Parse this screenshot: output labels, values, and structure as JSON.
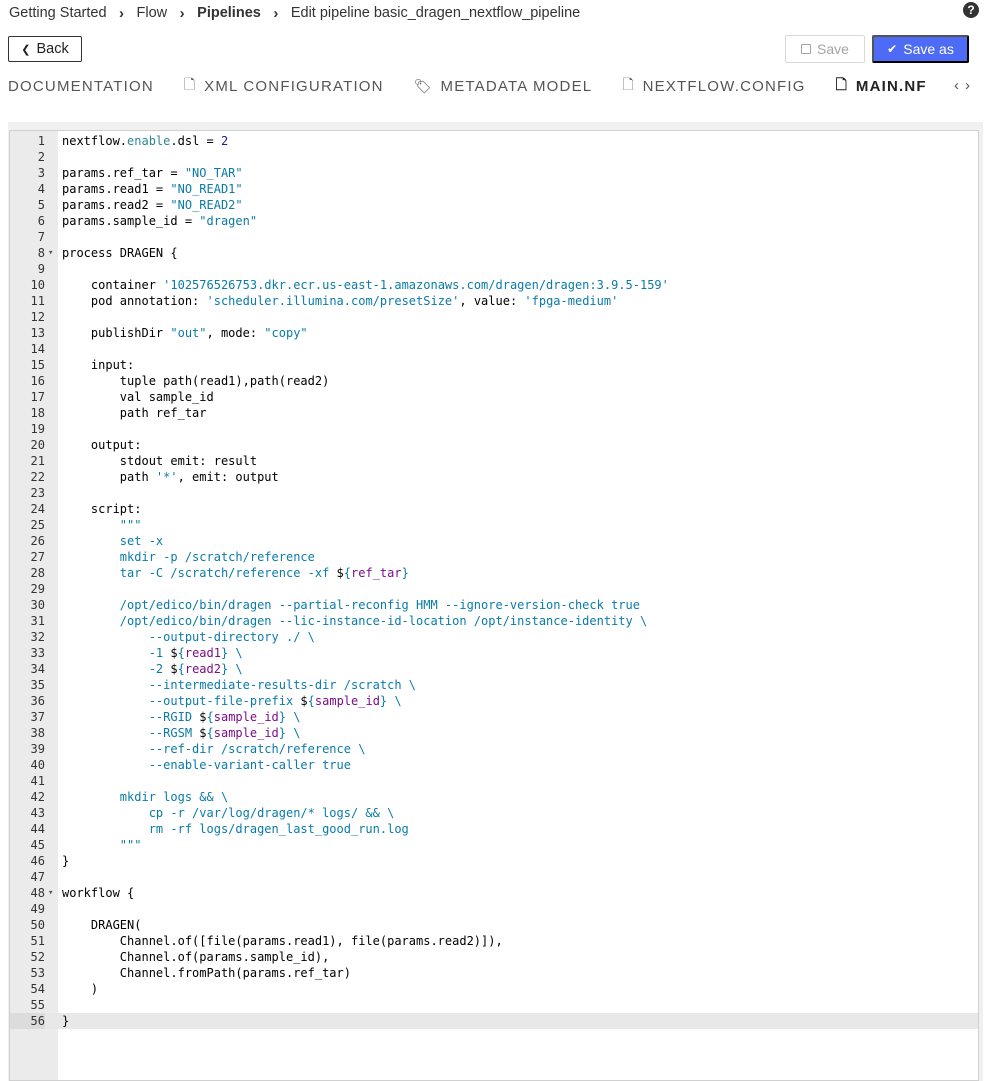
{
  "breadcrumb": {
    "items": [
      {
        "label": "Getting Started",
        "bold": false
      },
      {
        "label": "Flow",
        "bold": false
      },
      {
        "label": "Pipelines",
        "bold": true
      },
      {
        "label": "Edit pipeline basic_dragen_nextflow_pipeline",
        "bold": false
      }
    ],
    "separator": "›"
  },
  "header": {
    "help_icon": "question-circle-icon",
    "help_glyph": "?"
  },
  "toolbar": {
    "back_label": "Back",
    "back_glyph": "❮",
    "save_label": "Save",
    "save_glyph": "💾",
    "save_as_label": "Save as",
    "save_as_glyph": "✔",
    "save_as_color": "#4e6bf5"
  },
  "tabs": {
    "items": [
      {
        "label": "DOCUMENTATION",
        "icon": "",
        "active": false
      },
      {
        "label": "XML CONFIGURATION",
        "icon": "file-icon",
        "glyph": "🗋",
        "active": false
      },
      {
        "label": "METADATA MODEL",
        "icon": "tags-icon",
        "glyph": "🏷",
        "active": false
      },
      {
        "label": "NEXTFLOW.CONFIG",
        "icon": "file-icon",
        "glyph": "🗋",
        "active": false
      },
      {
        "label": "MAIN.NF",
        "icon": "file-icon",
        "glyph": "🗋",
        "active": true
      }
    ],
    "prev_glyph": "‹",
    "next_glyph": "›"
  },
  "editor": {
    "active_line": 56,
    "fold_glyph": "▾",
    "lines": [
      {
        "n": "1",
        "t": [
          [
            "tk-id",
            "nextflow."
          ],
          [
            "tk-prop",
            "enable"
          ],
          [
            "tk-id",
            ".dsl = "
          ],
          [
            "tk-num",
            "2"
          ]
        ]
      },
      {
        "n": "2",
        "t": []
      },
      {
        "n": "3",
        "t": [
          [
            "tk-id",
            "params.ref_tar = "
          ],
          [
            "tk-str2",
            "\"NO_TAR\""
          ]
        ]
      },
      {
        "n": "4",
        "t": [
          [
            "tk-id",
            "params.read1 = "
          ],
          [
            "tk-str2",
            "\"NO_READ1\""
          ]
        ]
      },
      {
        "n": "5",
        "t": [
          [
            "tk-id",
            "params.read2 = "
          ],
          [
            "tk-str2",
            "\"NO_READ2\""
          ]
        ]
      },
      {
        "n": "6",
        "t": [
          [
            "tk-id",
            "params.sample_id = "
          ],
          [
            "tk-str2",
            "\"dragen\""
          ]
        ]
      },
      {
        "n": "7",
        "t": []
      },
      {
        "n": "8",
        "fold": true,
        "t": [
          [
            "tk-id",
            "process DRAGEN {"
          ]
        ]
      },
      {
        "n": "9",
        "t": []
      },
      {
        "n": "10",
        "t": [
          [
            "tk-id",
            "    container "
          ],
          [
            "tk-str2",
            "'102576526753.dkr.ecr.us-east-1.amazonaws.com/dragen/dragen:3.9.5-159'"
          ]
        ]
      },
      {
        "n": "11",
        "t": [
          [
            "tk-id",
            "    pod annotation: "
          ],
          [
            "tk-str2",
            "'scheduler.illumina.com/presetSize'"
          ],
          [
            "tk-id",
            ", value: "
          ],
          [
            "tk-str2",
            "'fpga-medium'"
          ]
        ]
      },
      {
        "n": "12",
        "t": []
      },
      {
        "n": "13",
        "t": [
          [
            "tk-id",
            "    publishDir "
          ],
          [
            "tk-str2",
            "\"out\""
          ],
          [
            "tk-id",
            ", mode: "
          ],
          [
            "tk-str2",
            "\"copy\""
          ]
        ]
      },
      {
        "n": "14",
        "t": []
      },
      {
        "n": "15",
        "t": [
          [
            "tk-id",
            "    input:"
          ]
        ]
      },
      {
        "n": "16",
        "t": [
          [
            "tk-id",
            "        tuple path(read1),path(read2)"
          ]
        ]
      },
      {
        "n": "17",
        "t": [
          [
            "tk-id",
            "        val sample_id"
          ]
        ]
      },
      {
        "n": "18",
        "t": [
          [
            "tk-id",
            "        path ref_tar"
          ]
        ]
      },
      {
        "n": "19",
        "t": []
      },
      {
        "n": "20",
        "t": [
          [
            "tk-id",
            "    output:"
          ]
        ]
      },
      {
        "n": "21",
        "t": [
          [
            "tk-id",
            "        stdout emit: result"
          ]
        ]
      },
      {
        "n": "22",
        "t": [
          [
            "tk-id",
            "        path "
          ],
          [
            "tk-str2",
            "'*'"
          ],
          [
            "tk-id",
            ", emit: output"
          ]
        ]
      },
      {
        "n": "23",
        "t": []
      },
      {
        "n": "24",
        "t": [
          [
            "tk-id",
            "    script:"
          ]
        ]
      },
      {
        "n": "25",
        "t": [
          [
            "tk-str2",
            "        \"\"\""
          ]
        ]
      },
      {
        "n": "26",
        "t": [
          [
            "tk-str2",
            "        set -x"
          ]
        ]
      },
      {
        "n": "27",
        "t": [
          [
            "tk-str2",
            "        mkdir -p /scratch/reference"
          ]
        ]
      },
      {
        "n": "28",
        "t": [
          [
            "tk-str2",
            "        tar -C /scratch/reference -xf "
          ],
          [
            "tk-id",
            "$"
          ],
          [
            "tk-str2",
            "{"
          ],
          [
            "tk-var",
            "ref_tar"
          ],
          [
            "tk-str2",
            "}"
          ]
        ]
      },
      {
        "n": "29",
        "t": []
      },
      {
        "n": "30",
        "t": [
          [
            "tk-str2",
            "        /opt/edico/bin/dragen --partial-reconfig HMM --ignore-version-check true"
          ]
        ]
      },
      {
        "n": "31",
        "t": [
          [
            "tk-str2",
            "        /opt/edico/bin/dragen --lic-instance-id-location /opt/instance-identity \\\\"
          ]
        ]
      },
      {
        "n": "32",
        "t": [
          [
            "tk-str2",
            "            --output-directory ./ \\\\"
          ]
        ]
      },
      {
        "n": "33",
        "t": [
          [
            "tk-str2",
            "            -1 "
          ],
          [
            "tk-id",
            "$"
          ],
          [
            "tk-str2",
            "{"
          ],
          [
            "tk-var",
            "read1"
          ],
          [
            "tk-str2",
            "} \\\\"
          ]
        ]
      },
      {
        "n": "34",
        "t": [
          [
            "tk-str2",
            "            -2 "
          ],
          [
            "tk-id",
            "$"
          ],
          [
            "tk-str2",
            "{"
          ],
          [
            "tk-var",
            "read2"
          ],
          [
            "tk-str2",
            "} \\\\"
          ]
        ]
      },
      {
        "n": "35",
        "t": [
          [
            "tk-str2",
            "            --intermediate-results-dir /scratch \\\\"
          ]
        ]
      },
      {
        "n": "36",
        "t": [
          [
            "tk-str2",
            "            --output-file-prefix "
          ],
          [
            "tk-id",
            "$"
          ],
          [
            "tk-str2",
            "{"
          ],
          [
            "tk-var",
            "sample_id"
          ],
          [
            "tk-str2",
            "} \\\\"
          ]
        ]
      },
      {
        "n": "37",
        "t": [
          [
            "tk-str2",
            "            --RGID "
          ],
          [
            "tk-id",
            "$"
          ],
          [
            "tk-str2",
            "{"
          ],
          [
            "tk-var",
            "sample_id"
          ],
          [
            "tk-str2",
            "} \\\\"
          ]
        ]
      },
      {
        "n": "38",
        "t": [
          [
            "tk-str2",
            "            --RGSM "
          ],
          [
            "tk-id",
            "$"
          ],
          [
            "tk-str2",
            "{"
          ],
          [
            "tk-var",
            "sample_id"
          ],
          [
            "tk-str2",
            "} \\\\"
          ]
        ]
      },
      {
        "n": "39",
        "t": [
          [
            "tk-str2",
            "            --ref-dir /scratch/reference \\\\"
          ]
        ]
      },
      {
        "n": "40",
        "t": [
          [
            "tk-str2",
            "            --enable-variant-caller true"
          ]
        ]
      },
      {
        "n": "41",
        "t": []
      },
      {
        "n": "42",
        "t": [
          [
            "tk-str2",
            "        mkdir logs && \\\\"
          ]
        ]
      },
      {
        "n": "43",
        "t": [
          [
            "tk-str2",
            "            cp -r /var/log/dragen/* logs/ && \\\\"
          ]
        ]
      },
      {
        "n": "44",
        "t": [
          [
            "tk-str2",
            "            rm -rf logs/dragen_last_good_run.log"
          ]
        ]
      },
      {
        "n": "45",
        "t": [
          [
            "tk-str2",
            "        \"\"\""
          ]
        ]
      },
      {
        "n": "46",
        "t": [
          [
            "tk-id",
            "}"
          ]
        ]
      },
      {
        "n": "47",
        "t": []
      },
      {
        "n": "48",
        "fold": true,
        "t": [
          [
            "tk-id",
            "workflow {"
          ]
        ]
      },
      {
        "n": "49",
        "t": []
      },
      {
        "n": "50",
        "t": [
          [
            "tk-id",
            "    DRAGEN("
          ]
        ]
      },
      {
        "n": "51",
        "t": [
          [
            "tk-id",
            "        Channel.of([file(params.read1), file(params.read2)]),"
          ]
        ]
      },
      {
        "n": "52",
        "t": [
          [
            "tk-id",
            "        Channel.of(params.sample_id),"
          ]
        ]
      },
      {
        "n": "53",
        "t": [
          [
            "tk-id",
            "        Channel.fromPath(params.ref_tar)"
          ]
        ]
      },
      {
        "n": "54",
        "t": [
          [
            "tk-id",
            "    )"
          ]
        ]
      },
      {
        "n": "55",
        "t": []
      },
      {
        "n": "56",
        "t": [
          [
            "tk-id",
            "}"
          ]
        ]
      }
    ]
  }
}
